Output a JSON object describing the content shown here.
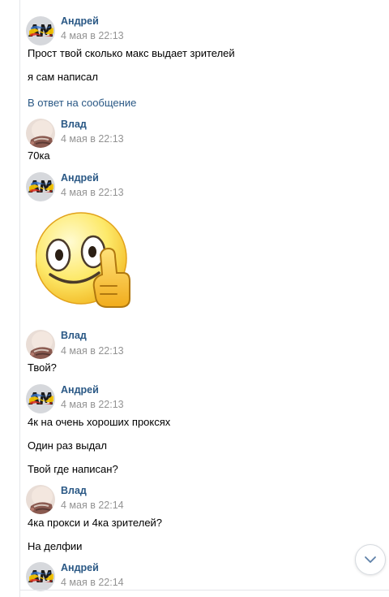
{
  "conversation": {
    "groups": [
      {
        "author": "Андрей",
        "time": "4 мая в 22:13",
        "avatar": "andrey-avatar-icon",
        "messages": [
          "Прост твой сколько макс выдает зрителей",
          "я сам написал"
        ],
        "reply_link": "В ответ на сообщение"
      },
      {
        "author": "Влад",
        "time": "4 мая в 22:13",
        "avatar": "vlad-avatar-icon",
        "messages": [
          "70ка"
        ]
      },
      {
        "author": "Андрей",
        "time": "4 мая в 22:13",
        "avatar": "andrey-avatar-icon",
        "sticker": "thumbs-up-smiley-sticker"
      },
      {
        "author": "Влад",
        "time": "4 мая в 22:13",
        "avatar": "vlad-avatar-icon",
        "messages": [
          "Твой?"
        ]
      },
      {
        "author": "Андрей",
        "time": "4 мая в 22:13",
        "avatar": "andrey-avatar-icon",
        "messages": [
          "4к на очень хороших проксях",
          "Один раз выдал",
          "Твой где написан?"
        ]
      },
      {
        "author": "Влад",
        "time": "4 мая в 22:14",
        "avatar": "vlad-avatar-icon",
        "messages": [
          "4ка прокси и 4ка зрителей?",
          "На делфии"
        ]
      },
      {
        "author": "Андрей",
        "time": "4 мая в 22:14",
        "avatar": "andrey-avatar-icon"
      }
    ]
  },
  "scroll_button": {
    "icon": "chevron-down-icon"
  },
  "colors": {
    "author_link": "#2a5885",
    "timestamp": "#939393",
    "message_text": "#000000",
    "divider": "#e4e6ea"
  }
}
